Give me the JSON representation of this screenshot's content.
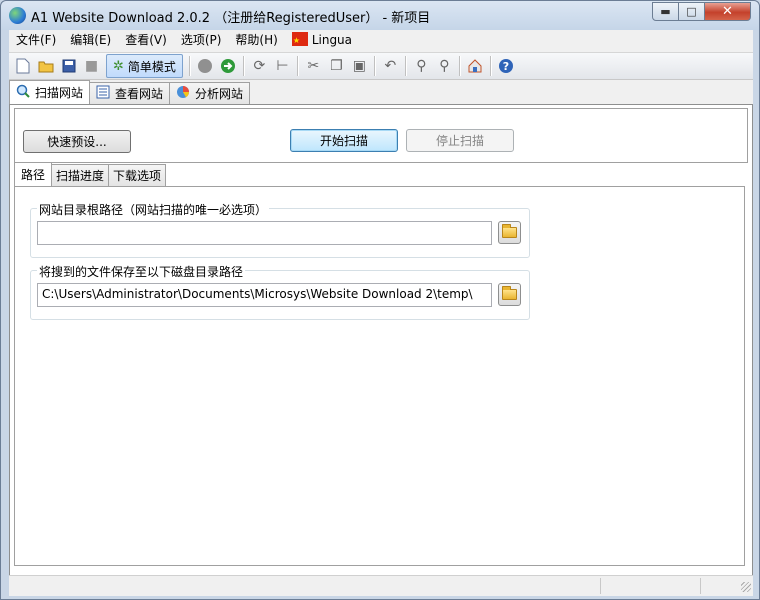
{
  "window": {
    "title": "A1 Website Download 2.0.2 （注册给RegisteredUser） - 新项目",
    "minimize": "▬",
    "maximize": "□",
    "close": "✕"
  },
  "menu": {
    "items": [
      "文件(F)",
      "编辑(E)",
      "查看(V)",
      "选项(P)",
      "帮助(H)"
    ],
    "lingua": "Lingua"
  },
  "toolbar": {
    "mode_label": "简单模式"
  },
  "main_tabs": [
    {
      "label": "扫描网站",
      "icon": "magnifier-icon"
    },
    {
      "label": "查看网站",
      "icon": "list-icon"
    },
    {
      "label": "分析网站",
      "icon": "chart-icon"
    }
  ],
  "scan": {
    "quick_preset_label": "快速预设...",
    "start_label": "开始扫描",
    "stop_label": "停止扫描"
  },
  "sub_tabs": [
    "路径",
    "扫描进度",
    "下载选项"
  ],
  "paths": {
    "root_group_title": "网站目录根路径（网站扫描的唯一必选项）",
    "root_value": "",
    "save_group_title": "将搜到的文件保存至以下磁盘目录路径",
    "save_value": "C:\\Users\\Administrator\\Documents\\Microsys\\Website Download 2\\temp\\"
  },
  "colors": {
    "title_bar": "#c9d6e6",
    "close_button": "#c4412b",
    "default_button": "#bee6fd"
  }
}
